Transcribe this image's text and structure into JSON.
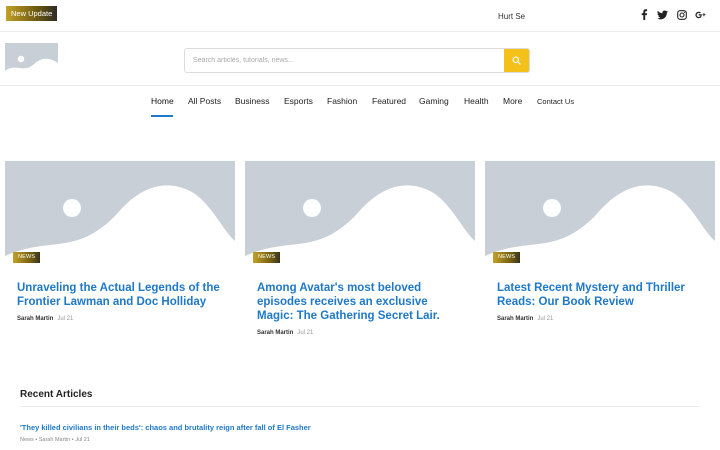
{
  "topbar": {
    "badge_label": "New Update",
    "ticker_text": "Hurt Se",
    "socials": [
      "facebook-icon",
      "twitter-icon",
      "instagram-icon",
      "google-plus-icon"
    ]
  },
  "header": {
    "logo_icon": "image-placeholder-icon",
    "search": {
      "placeholder": "Search articles, tutorials, news...",
      "value": ""
    },
    "search_icon": "search-icon",
    "accent_color": "#f4c11a"
  },
  "nav": {
    "items": [
      "Home",
      "All Posts",
      "Business",
      "Esports",
      "Fashion",
      "Featured",
      "Gaming",
      "Health",
      "More",
      "Contact Us"
    ],
    "active": "Home"
  },
  "cards": [
    {
      "category": "NEWS",
      "title": "Unraveling the Actual Legends of the Frontier Lawman and Doc Holliday",
      "author": "Sarah Martin",
      "date": "Jul 21"
    },
    {
      "category": "NEWS",
      "title": "Among Avatar's most beloved episodes receives an exclusive Magic: The Gathering Secret Lair.",
      "author": "Sarah Martin",
      "date": "Jul 21"
    },
    {
      "category": "NEWS",
      "title": "Latest Recent Mystery and Thriller Reads: Our Book Review",
      "author": "Sarah Martin",
      "date": "Jul 21"
    }
  ],
  "recent": {
    "heading": "Recent Articles",
    "items": [
      {
        "title": "'They killed civilians in their beds': chaos and brutality reign after fall of El Fasher",
        "meta": "News • Sarah Martin • Jul 21"
      }
    ]
  },
  "colors": {
    "link": "#1f78c8",
    "placeholder_image": "#c8cfd7"
  }
}
